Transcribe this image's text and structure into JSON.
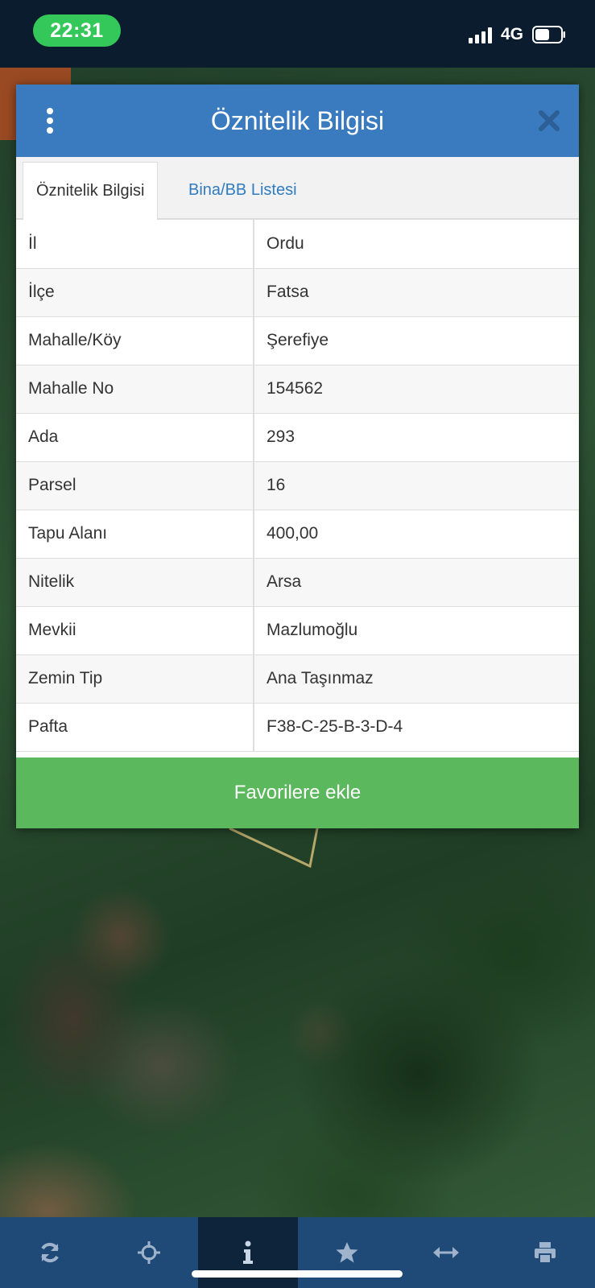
{
  "status_bar": {
    "time": "22:31",
    "network": "4G"
  },
  "dialog": {
    "title": "Öznitelik Bilgisi",
    "tabs": [
      {
        "label": "Öznitelik Bilgisi",
        "active": true
      },
      {
        "label": "Bina/BB Listesi",
        "active": false
      }
    ],
    "rows": [
      {
        "key": "İl",
        "value": "Ordu"
      },
      {
        "key": "İlçe",
        "value": "Fatsa"
      },
      {
        "key": "Mahalle/Köy",
        "value": "Şerefiye"
      },
      {
        "key": "Mahalle No",
        "value": "154562"
      },
      {
        "key": "Ada",
        "value": "293"
      },
      {
        "key": "Parsel",
        "value": "16"
      },
      {
        "key": "Tapu Alanı",
        "value": "400,00"
      },
      {
        "key": "Nitelik",
        "value": "Arsa"
      },
      {
        "key": "Mevkii",
        "value": "Mazlumoğlu"
      },
      {
        "key": "Zemin Tip",
        "value": "Ana Taşınmaz"
      },
      {
        "key": "Pafta",
        "value": "F38-C-25-B-3-D-4"
      }
    ],
    "favorite_button_label": "Favorilere ekle"
  },
  "toolbar": {
    "items": [
      {
        "icon": "refresh-icon",
        "active": false
      },
      {
        "icon": "locate-icon",
        "active": false
      },
      {
        "icon": "info-icon",
        "active": true
      },
      {
        "icon": "star-icon",
        "active": false
      },
      {
        "icon": "measure-icon",
        "active": false
      },
      {
        "icon": "print-icon",
        "active": false
      }
    ]
  },
  "colors": {
    "header_blue": "#3a7bbf",
    "tab_link_blue": "#2f7cc0",
    "favorite_green": "#5cb85c",
    "toolbar_blue": "#1f4a77",
    "time_pill_green": "#34c759"
  }
}
